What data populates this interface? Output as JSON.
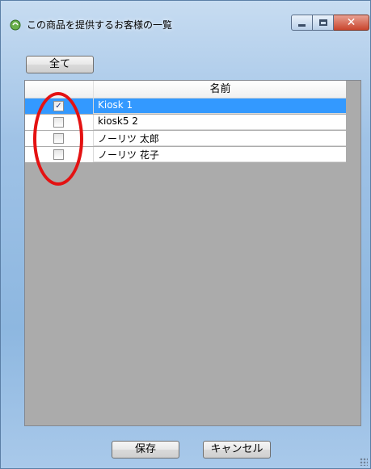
{
  "window": {
    "title": "この商品を提供するお客様の一覧",
    "close_symbol": "✕",
    "controls": [
      "minimize-icon",
      "maximize-icon",
      "close-icon"
    ]
  },
  "toolbar": {
    "select_all_label": "全て"
  },
  "grid": {
    "columns": [
      "",
      "名前"
    ],
    "rows": [
      {
        "checked": true,
        "check_mark": "✓",
        "name": "Kiosk 1",
        "selected": true
      },
      {
        "checked": false,
        "check_mark": "",
        "name": "kiosk5 2",
        "selected": false
      },
      {
        "checked": false,
        "check_mark": "",
        "name": "ノーリツ 太郎",
        "selected": false
      },
      {
        "checked": false,
        "check_mark": "",
        "name": "ノーリツ 花子",
        "selected": false
      }
    ]
  },
  "footer": {
    "save_label": "保存",
    "cancel_label": "キャンセル"
  },
  "colors": {
    "selection": "#3399ff",
    "annotation": "#e41212",
    "grid_bg": "#ababab"
  }
}
